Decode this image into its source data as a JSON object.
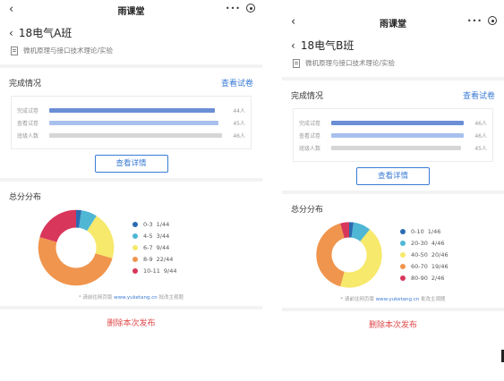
{
  "panels": [
    {
      "app_title": "雨课堂",
      "class_name": "18电气A班",
      "course_name": "微机原理与接口技术理论/实验",
      "completion_title": "完成情况",
      "view_paper": "查看试卷",
      "stats": [
        {
          "label": "完成试卷",
          "value": "44人",
          "fraction": 0.957,
          "color": "#6b8fd6"
        },
        {
          "label": "查看试卷",
          "value": "45人",
          "fraction": 0.978,
          "color": "#a9c0ee"
        },
        {
          "label": "班级人数",
          "value": "46人",
          "fraction": 1.0,
          "color": "#d6d6d6"
        }
      ],
      "detail_button": "查看详情",
      "distribution_title": "总分分布",
      "legend": [
        {
          "range": "0-3",
          "count": "1/44",
          "value": 1,
          "color": "#2b6cb0"
        },
        {
          "range": "4-5",
          "count": "3/44",
          "value": 3,
          "color": "#4fb6d4"
        },
        {
          "range": "6-7",
          "count": "9/44",
          "value": 9,
          "color": "#f6e96b"
        },
        {
          "range": "8-9",
          "count": "22/44",
          "value": 22,
          "color": "#f0954d"
        },
        {
          "range": "10-11",
          "count": "9/44",
          "value": 9,
          "color": "#d8365b"
        }
      ],
      "note_prefix": "* 请前往网页版",
      "note_url": "www.yuketang.cn",
      "note_suffix": "批改主观题",
      "delete_label": "删除本次发布"
    },
    {
      "app_title": "雨课堂",
      "class_name": "18电气B班",
      "course_name": "微机原理与接口技术理论/实验",
      "completion_title": "完成情况",
      "view_paper": "查看试卷",
      "stats": [
        {
          "label": "完成试卷",
          "value": "46人",
          "fraction": 1.0,
          "color": "#6b8fd6"
        },
        {
          "label": "查看试卷",
          "value": "46人",
          "fraction": 1.0,
          "color": "#a9c0ee"
        },
        {
          "label": "班级人数",
          "value": "45人",
          "fraction": 0.978,
          "color": "#d6d6d6"
        }
      ],
      "detail_button": "查看详情",
      "distribution_title": "总分分布",
      "legend": [
        {
          "range": "0-10",
          "count": "1/46",
          "value": 1,
          "color": "#2b6cb0"
        },
        {
          "range": "20-30",
          "count": "4/46",
          "value": 4,
          "color": "#4fb6d4"
        },
        {
          "range": "40-50",
          "count": "20/46",
          "value": 20,
          "color": "#f6e96b"
        },
        {
          "range": "60-70",
          "count": "19/46",
          "value": 19,
          "color": "#f0954d"
        },
        {
          "range": "80-90",
          "count": "2/46",
          "value": 2,
          "color": "#d8365b"
        }
      ],
      "note_prefix": "* 请前往网页版",
      "note_url": "www.yuketang.cn",
      "note_suffix": "批改主观题",
      "delete_label": "删除本次发布"
    }
  ]
}
